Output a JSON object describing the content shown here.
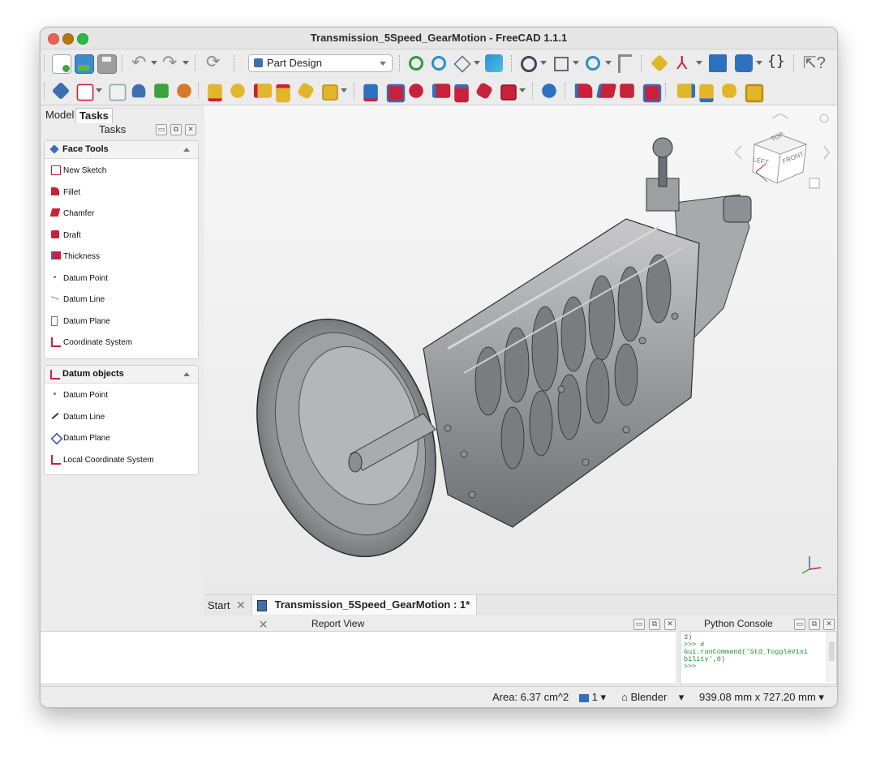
{
  "window": {
    "title": "Transmission_5Speed_GearMotion - FreeCAD 1.1.1"
  },
  "workbench": {
    "selected": "Part Design"
  },
  "toolbar_row1_icons": [
    "new-file",
    "open-file",
    "save",
    "undo",
    "redo",
    "refresh",
    "workbench-selector",
    "fit-all",
    "fit-selection",
    "draw-style",
    "view-box",
    "std-views",
    "zoom",
    "measure",
    "part",
    "datum-axes",
    "folder",
    "export",
    "macro",
    "whats-this"
  ],
  "toolbar_row2_icons": [
    "body",
    "sketch",
    "shapebinder",
    "clone",
    "subshapebinder",
    "sub-shapebinder",
    "pad",
    "revolve",
    "loft",
    "pipe",
    "helix",
    "additive-primitive",
    "pocket",
    "hole",
    "groove",
    "subtractive-loft",
    "subtractive-pipe",
    "subtractive-helix",
    "subtractive-primitive",
    "boolean",
    "fillet",
    "chamfer",
    "draft",
    "thickness",
    "mirrored",
    "linear-pattern",
    "polar-pattern",
    "multitransform"
  ],
  "left_tabs": [
    {
      "label": "Model"
    },
    {
      "label": "Tasks"
    }
  ],
  "tasks_header": "Tasks",
  "face_tools": {
    "title": "Face Tools",
    "items": [
      {
        "label": "New Sketch",
        "icon": "new-sketch-icon"
      },
      {
        "label": "Fillet",
        "icon": "fillet-icon"
      },
      {
        "label": "Chamfer",
        "icon": "chamfer-icon"
      },
      {
        "label": "Draft",
        "icon": "draft-icon"
      },
      {
        "label": "Thickness",
        "icon": "thickness-icon"
      },
      {
        "label": "Datum Point",
        "icon": "datum-point-icon"
      },
      {
        "label": "Datum Line",
        "icon": "datum-line-icon"
      },
      {
        "label": "Datum Plane",
        "icon": "datum-plane-icon"
      },
      {
        "label": "Coordinate System",
        "icon": "coordinate-system-icon"
      }
    ]
  },
  "datum_objects": {
    "title": "Datum objects",
    "items": [
      {
        "label": "Datum Point",
        "icon": "datum-point-icon"
      },
      {
        "label": "Datum Line",
        "icon": "datum-line-icon"
      },
      {
        "label": "Datum Plane",
        "icon": "datum-plane-icon"
      },
      {
        "label": "Local Coordinate System",
        "icon": "local-coordinate-system-icon"
      }
    ]
  },
  "navcube": {
    "top": "TOP",
    "left": "LEFT",
    "front": "FRONT"
  },
  "doc_tabs": [
    {
      "label": "Start"
    },
    {
      "label": "Transmission_5Speed_GearMotion : 1*"
    }
  ],
  "report_view": {
    "title": "Report View"
  },
  "python_console": {
    "title": "Python Console",
    "lines": [
      "3)",
      ">>> #",
      "Gui.runCommand('Std_ToggleVisi",
      "bility',0)",
      ">>>"
    ]
  },
  "status": {
    "area": "Area: 6.37 cm^2",
    "layer_count": "1",
    "nav_style": "Blender",
    "dimensions": "939.08 mm x 727.20 mm"
  },
  "colors": {
    "accent_blue": "#2f6fbf",
    "part_red": "#c8223a",
    "yellow": "#e2b62a"
  }
}
